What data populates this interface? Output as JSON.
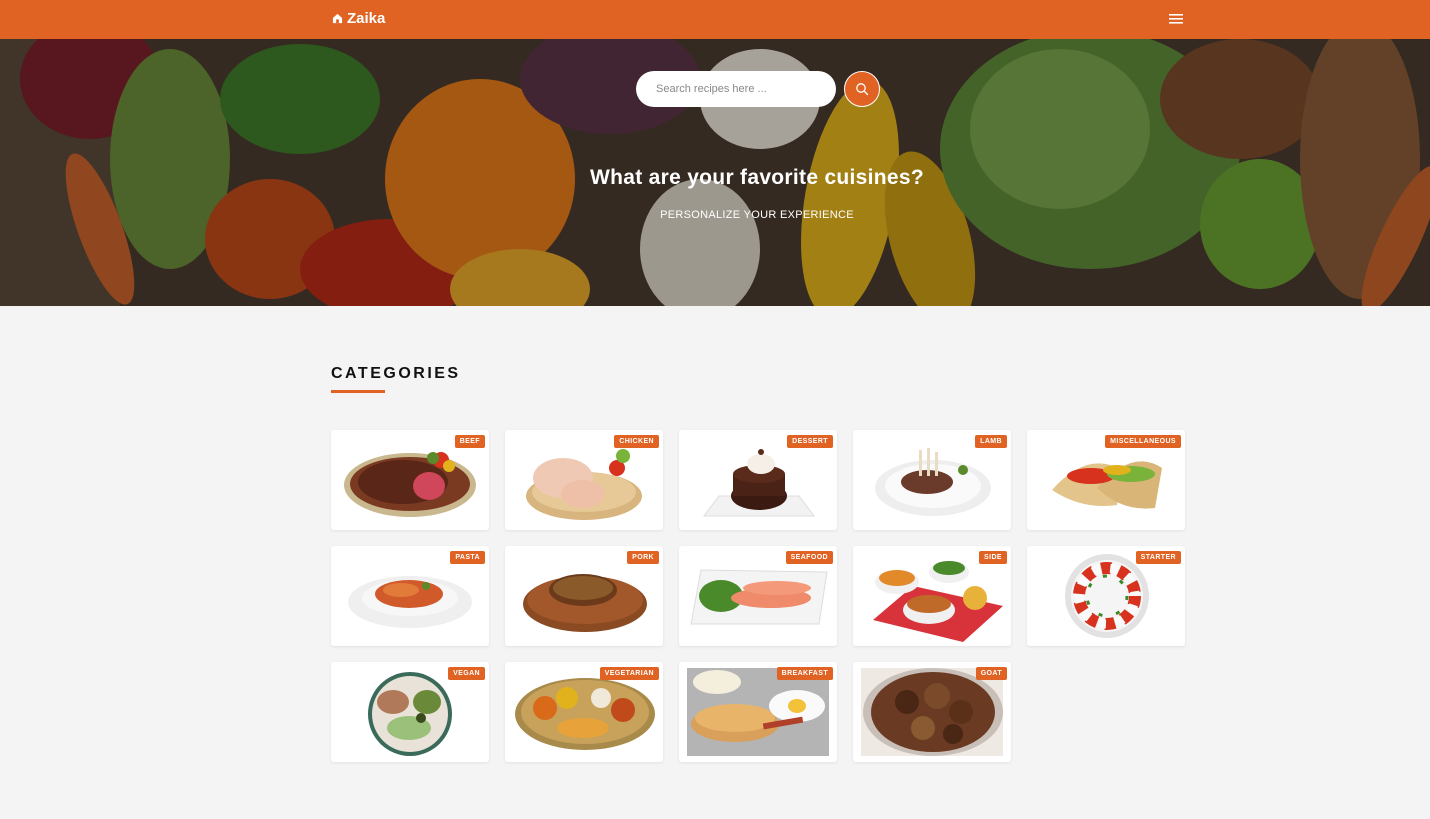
{
  "brand": {
    "name": "Zaika",
    "color": "#e06324"
  },
  "nav": {
    "menu_icon": "hamburger-icon"
  },
  "hero": {
    "search_placeholder": "Search recipes here ...",
    "search_icon": "search-icon",
    "title": "What are your favorite cuisines?",
    "subtitle": "PERSONALIZE YOUR EXPERIENCE"
  },
  "categories": {
    "heading": "CATEGORIES",
    "items": [
      {
        "label": "BEEF"
      },
      {
        "label": "CHICKEN"
      },
      {
        "label": "DESSERT"
      },
      {
        "label": "LAMB"
      },
      {
        "label": "MISCELLANEOUS"
      },
      {
        "label": "PASTA"
      },
      {
        "label": "PORK"
      },
      {
        "label": "SEAFOOD"
      },
      {
        "label": "SIDE"
      },
      {
        "label": "STARTER"
      },
      {
        "label": "VEGAN"
      },
      {
        "label": "VEGETARIAN"
      },
      {
        "label": "BREAKFAST"
      },
      {
        "label": "GOAT"
      }
    ]
  }
}
